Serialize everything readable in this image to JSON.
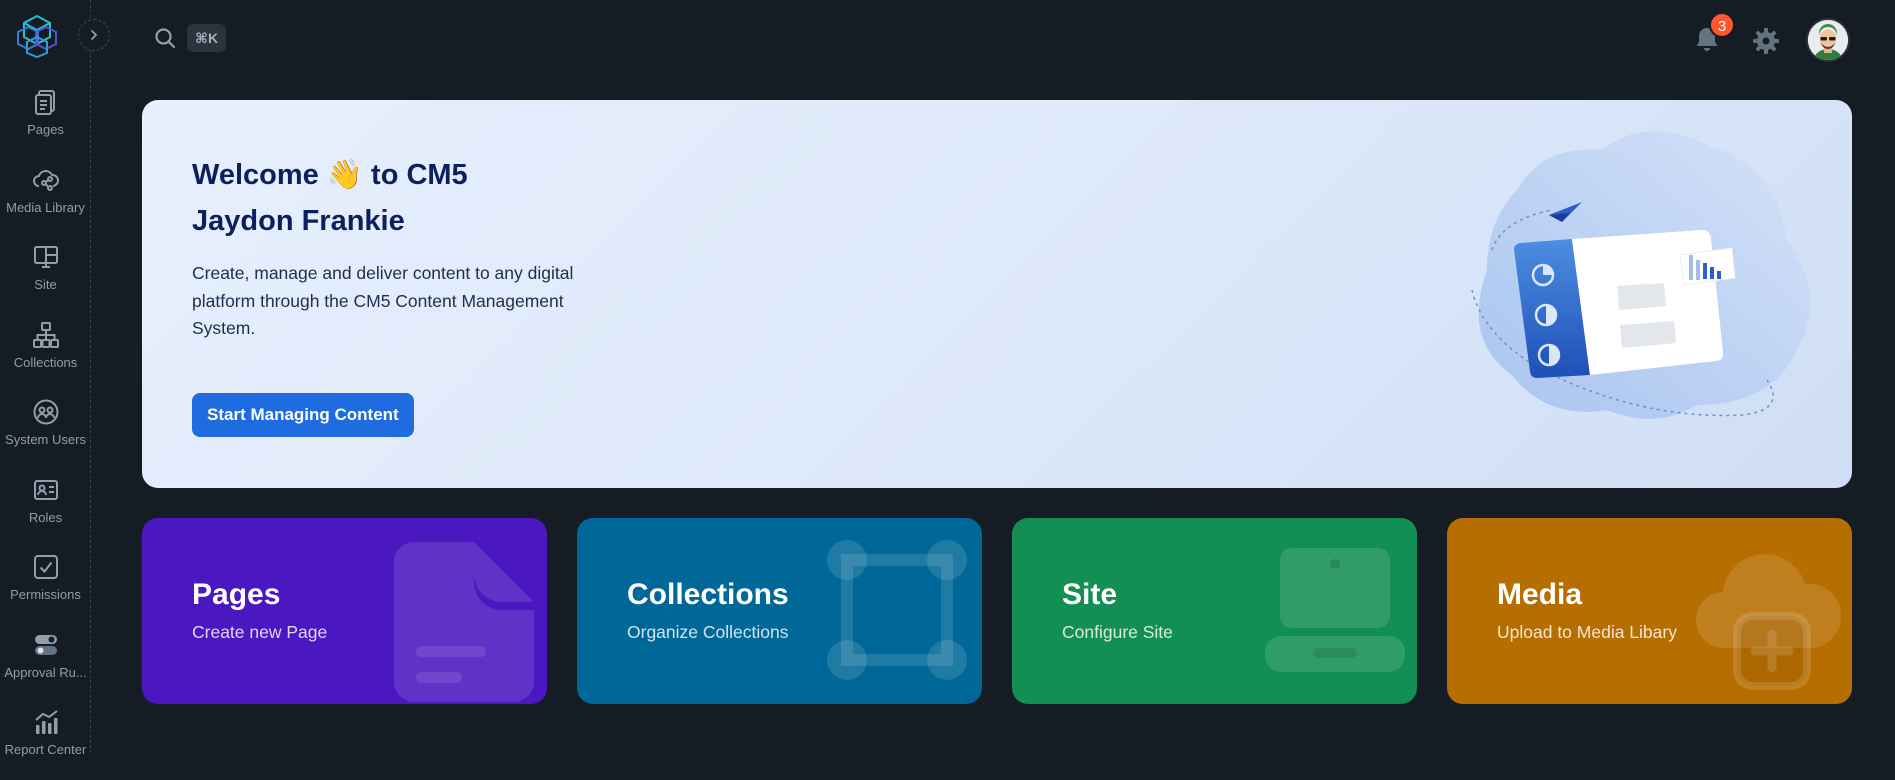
{
  "header": {
    "search_shortcut": "⌘K",
    "notifications_count": "3"
  },
  "sidebar": {
    "items": [
      {
        "label": "Pages",
        "icon": "pages-icon"
      },
      {
        "label": "Media Library",
        "icon": "media-library-icon"
      },
      {
        "label": "Site",
        "icon": "site-icon"
      },
      {
        "label": "Collections",
        "icon": "collections-icon"
      },
      {
        "label": "System Users",
        "icon": "system-users-icon"
      },
      {
        "label": "Roles",
        "icon": "roles-icon"
      },
      {
        "label": "Permissions",
        "icon": "permissions-icon"
      },
      {
        "label": "Approval Ru...",
        "icon": "approval-rules-icon"
      },
      {
        "label": "Report Center",
        "icon": "report-center-icon"
      }
    ]
  },
  "welcome": {
    "title_line1_prefix": "Welcome",
    "wave_emoji": "👋",
    "title_line1_suffix": "to CM5",
    "user_name": "Jaydon Frankie",
    "description": "Create, manage and deliver content to any digital platform through the CM5 Content Management System.",
    "cta_label": "Start Managing Content"
  },
  "cards": [
    {
      "title": "Pages",
      "subtitle": "Create new Page",
      "color": "#4a17c0"
    },
    {
      "title": "Collections",
      "subtitle": "Organize Collections",
      "color": "#006898"
    },
    {
      "title": "Site",
      "subtitle": "Configure Site",
      "color": "#148f53"
    },
    {
      "title": "Media",
      "subtitle": "Upload to Media Libary",
      "color": "#b76e00"
    }
  ],
  "colors": {
    "background": "#161c24",
    "accent": "#1f6be0",
    "badge": "#ff5630"
  }
}
